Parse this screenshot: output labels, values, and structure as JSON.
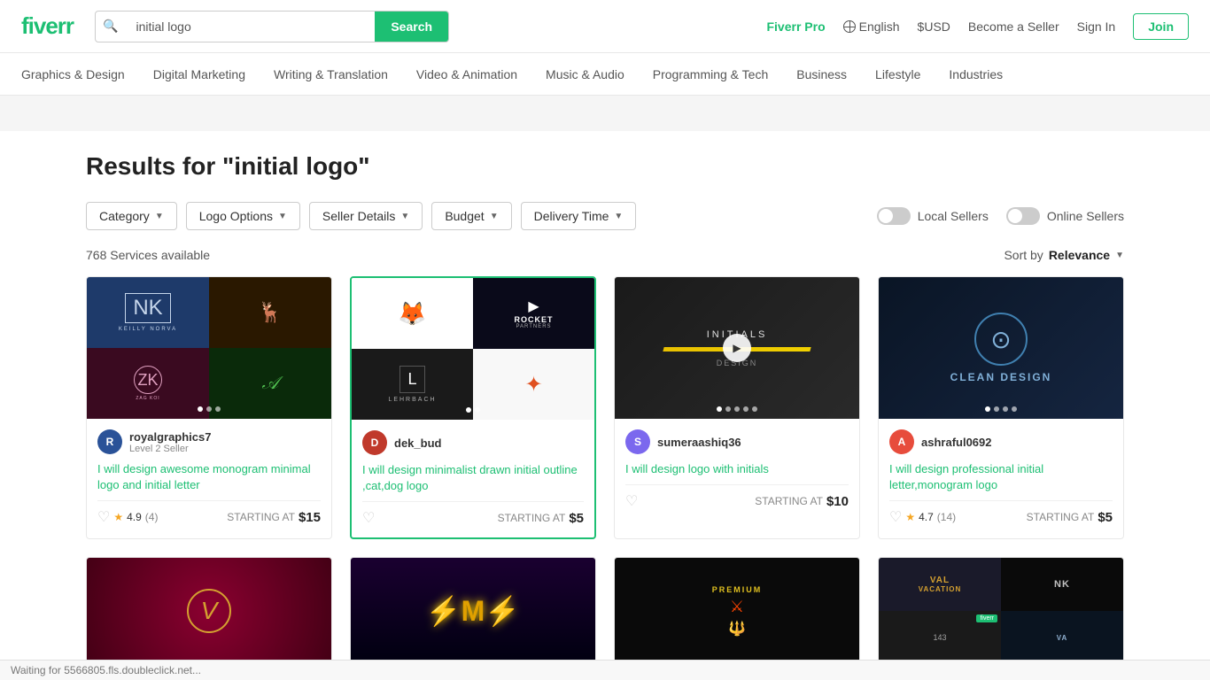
{
  "header": {
    "logo": "fiverr",
    "search_placeholder": "initial logo",
    "search_button": "Search",
    "fiverr_pro": "Fiverr Pro",
    "language": "English",
    "currency": "$USD",
    "become_seller": "Become a Seller",
    "sign_in": "Sign In",
    "join": "Join"
  },
  "nav": {
    "items": [
      "Graphics & Design",
      "Digital Marketing",
      "Writing & Translation",
      "Video & Animation",
      "Music & Audio",
      "Programming & Tech",
      "Business",
      "Lifestyle",
      "Industries"
    ]
  },
  "results": {
    "title": "Results for \"initial logo\"",
    "count": "768 Services available",
    "sort_label": "Sort by",
    "sort_value": "Relevance"
  },
  "filters": {
    "category": "Category",
    "logo_options": "Logo Options",
    "seller_details": "Seller Details",
    "budget": "Budget",
    "delivery_time": "Delivery Time",
    "local_sellers": "Local Sellers",
    "online_sellers": "Online Sellers"
  },
  "cards": [
    {
      "seller": "royalgraphics7",
      "level": "Level 2 Seller",
      "title": "I will design awesome monogram minimal logo and initial letter",
      "rating": "4.9",
      "reviews": "(4)",
      "starting_at": "STARTING AT",
      "price": "$15",
      "avatar_color": "#2a5298",
      "avatar_letter": "R"
    },
    {
      "seller": "dek_bud",
      "level": "",
      "title": "I will design minimalist drawn initial outline ,cat,dog logo",
      "rating": "",
      "reviews": "",
      "starting_at": "STARTING AT",
      "price": "$5",
      "avatar_color": "#c0392b",
      "avatar_letter": "D",
      "is_highlighted": true
    },
    {
      "seller": "sumeraashiq36",
      "level": "",
      "title": "I will design logo with initials",
      "rating": "",
      "reviews": "",
      "starting_at": "STARTING AT",
      "price": "$10",
      "avatar_color": "#7b68ee",
      "avatar_letter": "S"
    },
    {
      "seller": "ashraful0692",
      "level": "",
      "title": "I will design professional initial letter,monogram logo",
      "rating": "4.7",
      "reviews": "(14)",
      "starting_at": "STARTING AT",
      "price": "$5",
      "avatar_color": "#e74c3c",
      "avatar_letter": "A"
    }
  ],
  "status_bar": {
    "text": "Waiting for 5566805.fls.doubleclick.net..."
  }
}
